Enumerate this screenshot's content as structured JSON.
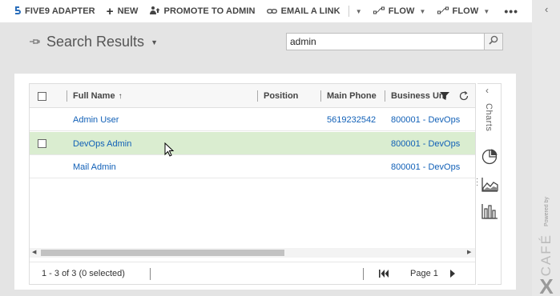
{
  "command_bar": {
    "items": [
      {
        "label": "FIVE9 ADAPTER",
        "icon": "five9-icon"
      },
      {
        "label": "NEW",
        "icon": "plus-icon"
      },
      {
        "label": "PROMOTE TO ADMIN",
        "icon": "promote-icon"
      },
      {
        "label": "EMAIL A LINK",
        "icon": "link-icon"
      },
      {
        "label": "FLOW",
        "icon": "flow-icon"
      },
      {
        "label": "FLOW",
        "icon": "flow-icon"
      }
    ],
    "more": "•••"
  },
  "header": {
    "title": "Search Results",
    "search_value": "admin"
  },
  "grid": {
    "columns": [
      "Full Name",
      "Position",
      "Main Phone",
      "Business Uni"
    ],
    "rows": [
      {
        "full_name": "Admin User",
        "position": "",
        "main_phone": "5619232542",
        "business_unit": "800001 - DevOps"
      },
      {
        "full_name": "DevOps Admin",
        "position": "",
        "main_phone": "",
        "business_unit": "800001 - DevOps"
      },
      {
        "full_name": "Mail Admin",
        "position": "",
        "main_phone": "",
        "business_unit": "800001 - DevOps"
      }
    ],
    "status": "1 - 3 of 3 (0 selected)",
    "page_label": "Page 1"
  },
  "charts_pane": {
    "label": "Charts"
  },
  "branding": {
    "powered_by": "Powered by",
    "name": "CAFÉ",
    "mark": "X"
  },
  "colors": {
    "accent_link": "#1160b7",
    "selected_row": "#daedd0",
    "band": "#e4e4e4"
  }
}
